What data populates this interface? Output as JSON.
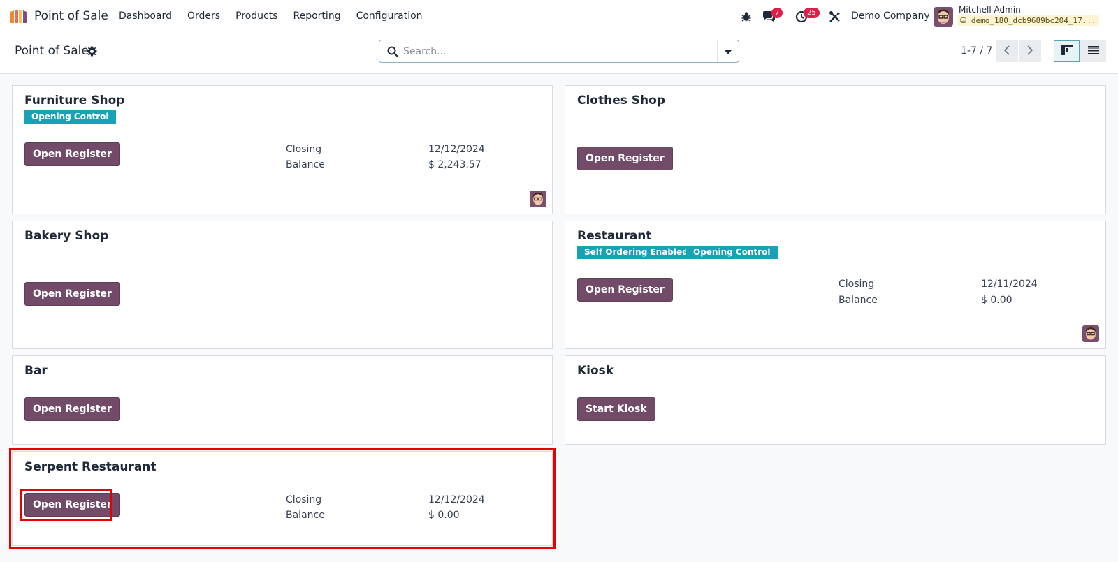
{
  "navbar": {
    "app_name": "Point of Sale",
    "menu": [
      "Dashboard",
      "Orders",
      "Products",
      "Reporting",
      "Configuration"
    ],
    "messages_count": "7",
    "activities_count": "25",
    "company": "Demo Company",
    "user_name": "Mitchell Admin",
    "db_name": "demo_180_dcb9689bc204_17..."
  },
  "control_panel": {
    "title": "Point of Sale",
    "search_placeholder": "Search...",
    "pager": "1-7 / 7"
  },
  "cards": [
    {
      "title": "Furniture Shop",
      "tags": [
        "Opening Control"
      ],
      "button": "Open Register",
      "closing_label": "Closing",
      "closing_value": "12/12/2024",
      "balance_label": "Balance",
      "balance_value": "$ 2,243.57"
    },
    {
      "title": "Clothes Shop",
      "tags": [],
      "button": "Open Register"
    },
    {
      "title": "Bakery Shop",
      "tags": [],
      "button": "Open Register"
    },
    {
      "title": "Restaurant",
      "tags": [
        "Self Ordering Enabled",
        "Opening Control"
      ],
      "button": "Open Register",
      "closing_label": "Closing",
      "closing_value": "12/11/2024",
      "balance_label": "Balance",
      "balance_value": "$ 0.00"
    },
    {
      "title": "Bar",
      "tags": [],
      "button": "Open Register"
    },
    {
      "title": "Kiosk",
      "tags": [],
      "button": "Start Kiosk"
    },
    {
      "title": "Serpent Restaurant",
      "tags": [],
      "button": "Open Register",
      "closing_label": "Closing",
      "closing_value": "12/12/2024",
      "balance_label": "Balance",
      "balance_value": "$ 0.00"
    }
  ],
  "colors": {
    "primary": "#714b67",
    "tag": "#17a2b8",
    "highlight": "#e60000",
    "badge": "#e11d48"
  },
  "icons": [
    "app-logo-icon",
    "bug-icon",
    "chat-icon",
    "clock-icon",
    "tools-icon",
    "gear-icon",
    "search-icon",
    "caret-down-icon",
    "chevron-left-icon",
    "chevron-right-icon",
    "kanban-view-icon",
    "list-view-icon"
  ]
}
